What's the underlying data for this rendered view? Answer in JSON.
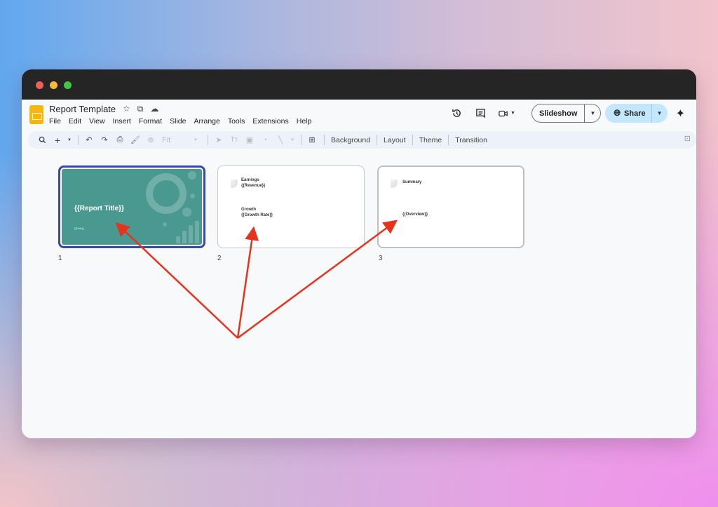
{
  "window": {
    "traffic_lights": [
      "close",
      "minimize",
      "maximize"
    ]
  },
  "app": {
    "doc_title": "Report Template",
    "title_icons": [
      "star-icon",
      "move-to-folder-icon",
      "cloud-saved-icon"
    ],
    "menu": [
      "File",
      "Edit",
      "View",
      "Insert",
      "Format",
      "Slide",
      "Arrange",
      "Tools",
      "Extensions",
      "Help"
    ],
    "header_actions": {
      "history_icon": "version-history-icon",
      "comments_icon": "comments-icon",
      "meet_icon": "video-call-icon",
      "slideshow_label": "Slideshow",
      "share_label": "Share",
      "gemini_icon": "gemini-spark-icon"
    }
  },
  "toolbar": {
    "zoom_value": "Fit",
    "text_buttons": [
      "Background",
      "Layout",
      "Theme",
      "Transition"
    ]
  },
  "slides": [
    {
      "number": "1",
      "selected": true,
      "title": "{{Report Title}}",
      "subtitle": "{{Date}}",
      "theme_color": "#4a9991"
    },
    {
      "number": "2",
      "selected": false,
      "blocks": [
        {
          "heading": "Earnings",
          "value": "{{Revenue}}"
        },
        {
          "heading": "Growth",
          "value": "{{Growth Rate}}"
        }
      ]
    },
    {
      "number": "3",
      "selected": false,
      "heading": "Summary",
      "value": "{{Overview}}"
    }
  ],
  "annotation": {
    "arrow_color": "#e8331c",
    "arrow_targets": [
      "slide 1 title",
      "slide 2 growth rate",
      "slide 3 overview"
    ]
  },
  "colors": {
    "share_bg": "#c2e7ff",
    "selected_border": "#3949ab",
    "toolbar_bg": "#edf2fa"
  }
}
